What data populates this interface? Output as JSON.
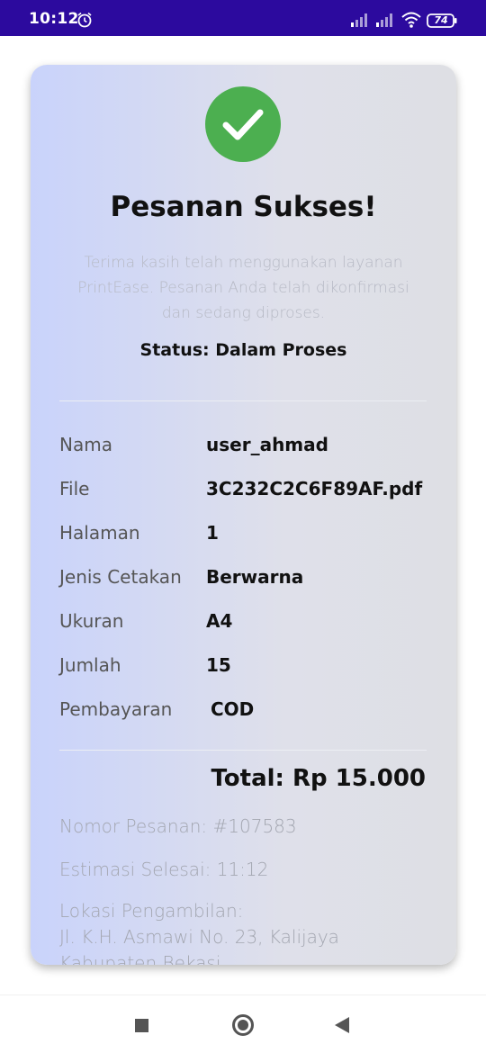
{
  "status_bar": {
    "time": "10:12",
    "battery": "74",
    "icons": [
      "alarm-icon",
      "signal-icon",
      "signal-icon",
      "wifi-icon",
      "battery-icon"
    ]
  },
  "confirmation": {
    "icon": "check-circle-icon",
    "title": "Pesanan Sukses!",
    "message": "Terima kasih telah menggunakan layanan PrintEase. Pesanan Anda telah dikonfirmasi dan sedang diproses.",
    "status": "Status: Dalam Proses"
  },
  "details": [
    {
      "label": "Nama",
      "value": "user_ahmad"
    },
    {
      "label": "File",
      "value": "3C232C2C6F89AF.pdf"
    },
    {
      "label": "Halaman",
      "value": "1"
    },
    {
      "label": "Jenis Cetakan",
      "value": "Berwarna"
    },
    {
      "label": "Ukuran",
      "value": "A4"
    },
    {
      "label": "Jumlah",
      "value": "15"
    },
    {
      "label": "Pembayaran",
      "value": " COD"
    }
  ],
  "total": "Total: Rp 15.000",
  "order_number": "Nomor Pesanan: #107583",
  "estimate": "Estimasi Selesai: 11:12",
  "pickup": {
    "label": "Lokasi Pengambilan:",
    "address_line1": "Jl. K.H. Asmawi No. 23, Kalijaya",
    "address_line2": "Kabupaten Bekasi"
  },
  "colors": {
    "status_bar": "#2c0a9e",
    "success": "#4caf50",
    "card_gradient_start": "#c9d3fb",
    "card_gradient_end": "#dedfe4"
  },
  "nav_bar": {
    "icons": [
      "recents-square-icon",
      "home-circle-icon",
      "back-triangle-icon"
    ]
  }
}
